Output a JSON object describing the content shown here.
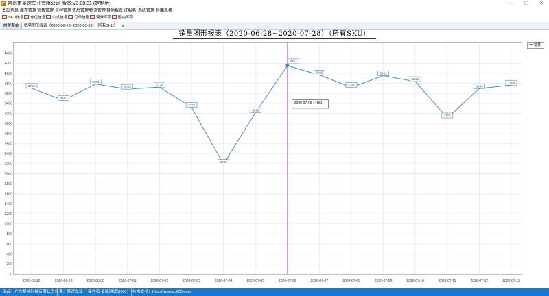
{
  "window": {
    "title": "常州市豪速车业有限公司 版本:V3.08.31 (定制版)"
  },
  "menu": {
    "items": [
      "基础信息",
      "库存管理",
      "销售管理",
      "头程管理",
      "售后管理",
      "物流管理",
      "其他报表",
      "IT服务",
      "系统管理",
      "界面风格"
    ]
  },
  "toolbar": {
    "items": [
      {
        "label": "SKU信息",
        "icon": "sku-icon"
      },
      {
        "label": "仓位信息",
        "icon": "location-icon"
      },
      {
        "label": "公式信息",
        "icon": "formula-icon"
      },
      {
        "label": "订单信息",
        "icon": "order-icon"
      },
      {
        "label": "海外库存",
        "icon": "overseas-stock-icon"
      },
      {
        "label": "国内库存",
        "icon": "domestic-stock-icon"
      }
    ]
  },
  "tabs": [
    {
      "label": "树型菜单"
    },
    {
      "label": "销量图形报表（2020-06-28~2020-07-28）（所有SKU）"
    }
  ],
  "tooltip": {
    "text": "2020-07-06 : 4151"
  },
  "status": {
    "items": [
      "出品：广东星域科技有限公司",
      "帐套：豪速车业",
      "操作员:星域测试(0001)",
      "技术支持：http://www.xc200.com"
    ]
  },
  "colors": {
    "accent": "#1678d1",
    "line": "#4a87c8",
    "cursor": "#e040e0"
  },
  "chart_data": {
    "type": "line",
    "title": "销量图形报表（2020-06-28~2020-07-28）（所有SKU）",
    "x": [
      "2020-06-28",
      "2020-06-29",
      "2020-06-30",
      "2020-07-01",
      "2020-07-02",
      "2020-07-03",
      "2020-07-04",
      "2020-07-05",
      "2020-07-06",
      "2020-07-07",
      "2020-07-08",
      "2020-07-09",
      "2020-07-10",
      "2020-07-11",
      "2020-07-12",
      "2020-07-13"
    ],
    "series": [
      {
        "name": "销量",
        "values": [
          3702,
          3462,
          3786,
          3684,
          3725,
          3323,
          2189,
          3218,
          4151,
          3965,
          3721,
          3951,
          3835,
          3112,
          3696,
          3764
        ]
      }
    ],
    "ylim": [
      0,
      4600
    ],
    "yticks": [
      0,
      200,
      400,
      600,
      800,
      1000,
      1200,
      1400,
      1600,
      1800,
      2000,
      2200,
      2400,
      2600,
      2800,
      3000,
      3200,
      3400,
      3600,
      3800,
      4000,
      4200,
      4400
    ],
    "highlight_index": 8,
    "legend": "top-right",
    "grid": true
  }
}
